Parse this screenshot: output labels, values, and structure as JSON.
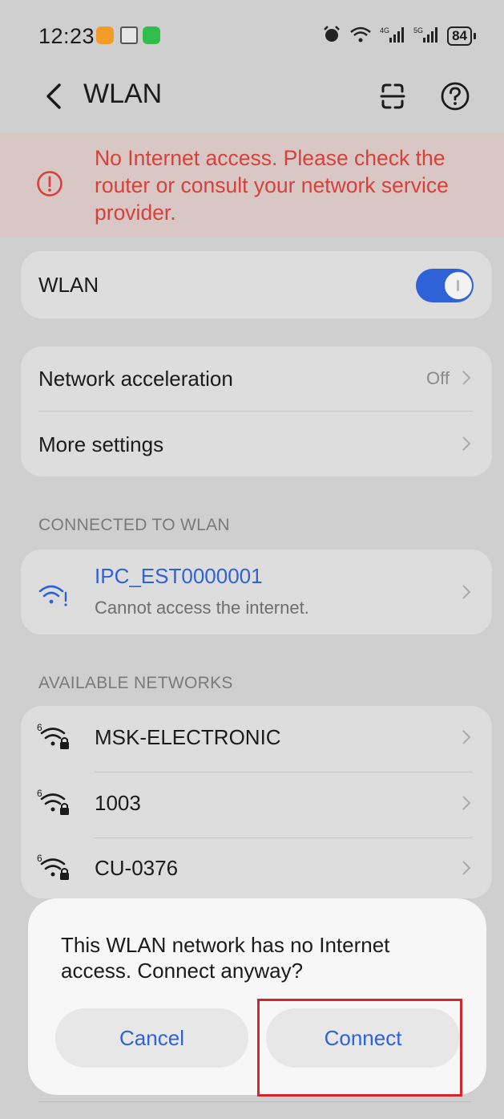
{
  "status_bar": {
    "time": "12:23",
    "battery": "84"
  },
  "app_bar": {
    "title": "WLAN",
    "back_icon": "chevron-left-icon",
    "scan_icon": "scan-icon",
    "help_icon": "help-circle-icon"
  },
  "alert": {
    "text": "No Internet access. Please check the router or consult your network service provider.",
    "color": "#d6423b"
  },
  "wlan": {
    "label": "WLAN",
    "enabled": true
  },
  "settings": {
    "network_acceleration": {
      "label": "Network acceleration",
      "value": "Off"
    },
    "more_settings": {
      "label": "More settings"
    }
  },
  "connected": {
    "header": "CONNECTED TO WLAN",
    "ssid": "IPC_EST0000001",
    "status": "Cannot access the internet."
  },
  "available": {
    "header": "AVAILABLE NETWORKS",
    "networks": [
      {
        "ssid": "MSK-ELECTRONIC"
      },
      {
        "ssid": "1003"
      },
      {
        "ssid": "CU-0376"
      }
    ]
  },
  "dialog": {
    "message": "This WLAN network has no Internet access. Connect anyway?",
    "cancel_label": "Cancel",
    "connect_label": "Connect"
  },
  "colors": {
    "accent": "#2f62d6",
    "highlight": "#d4262c"
  }
}
